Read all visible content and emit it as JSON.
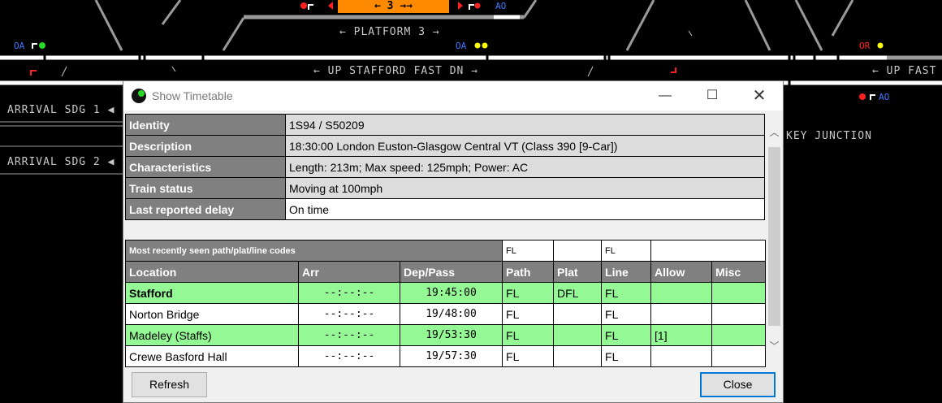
{
  "background": {
    "platform_box": "← 3 →→",
    "platform_label": "← PLATFORM 3 →",
    "up_stafford_label": "← UP STAFFORD FAST DN →",
    "up_fast_label": "← UP FAST",
    "arrival_sdg_1": "ARRIVAL SDG 1 ◀",
    "arrival_sdg_2": "ARRIVAL SDG 2 ◀",
    "junction_label": "KEY JUNCTION",
    "signal_ao_top": "AO",
    "signal_oa_left": "OA",
    "signal_oa_mid": "OA",
    "signal_or_right": "OR",
    "signal_ao_right": "AO"
  },
  "dialog": {
    "title": "Show Timetable",
    "info_rows": [
      {
        "label": "Identity",
        "value": "1S94 / S50209"
      },
      {
        "label": "Description",
        "value": "18:30:00 London Euston-Glasgow Central VT (Class 390 [9-Car])"
      },
      {
        "label": "Characteristics",
        "value": "Length: 213m; Max speed: 125mph; Power: AC"
      },
      {
        "label": "Train status",
        "value": "Moving at 100mph"
      },
      {
        "label": "Last reported delay",
        "value": "On time"
      }
    ],
    "codes_caption": "Most recently seen path/plat/line codes",
    "codes": {
      "path": "FL",
      "plat": "",
      "line": "FL",
      "allow": ""
    },
    "headers": {
      "location": "Location",
      "arr": "Arr",
      "dep": "Dep/Pass",
      "path": "Path",
      "plat": "Plat",
      "line": "Line",
      "allow": "Allow",
      "misc": "Misc"
    },
    "rows": [
      {
        "location": "Stafford",
        "arr": "--:--:--",
        "dep": "19:45:00",
        "path": "FL",
        "plat": "DFL",
        "line": "FL",
        "allow": "",
        "misc": ""
      },
      {
        "location": "Norton Bridge",
        "arr": "--:--:--",
        "dep": "19/48:00",
        "path": "FL",
        "plat": "",
        "line": "FL",
        "allow": "",
        "misc": ""
      },
      {
        "location": "Madeley (Staffs)",
        "arr": "--:--:--",
        "dep": "19/53:30",
        "path": "FL",
        "plat": "",
        "line": "FL",
        "allow": "[1]",
        "misc": ""
      },
      {
        "location": "Crewe Basford Hall",
        "arr": "--:--:--",
        "dep": "19/57:30",
        "path": "FL",
        "plat": "",
        "line": "FL",
        "allow": "",
        "misc": ""
      }
    ],
    "refresh_label": "Refresh",
    "close_label": "Close",
    "min_icon": "—",
    "max_icon": "☐",
    "close_icon": "✕"
  },
  "colors": {
    "platform_occupied": "#ff8a00",
    "row_highlight": "#94f894",
    "header_gray": "#808080",
    "signal_blue": "#3c7bff",
    "signal_red": "#ff2020"
  }
}
